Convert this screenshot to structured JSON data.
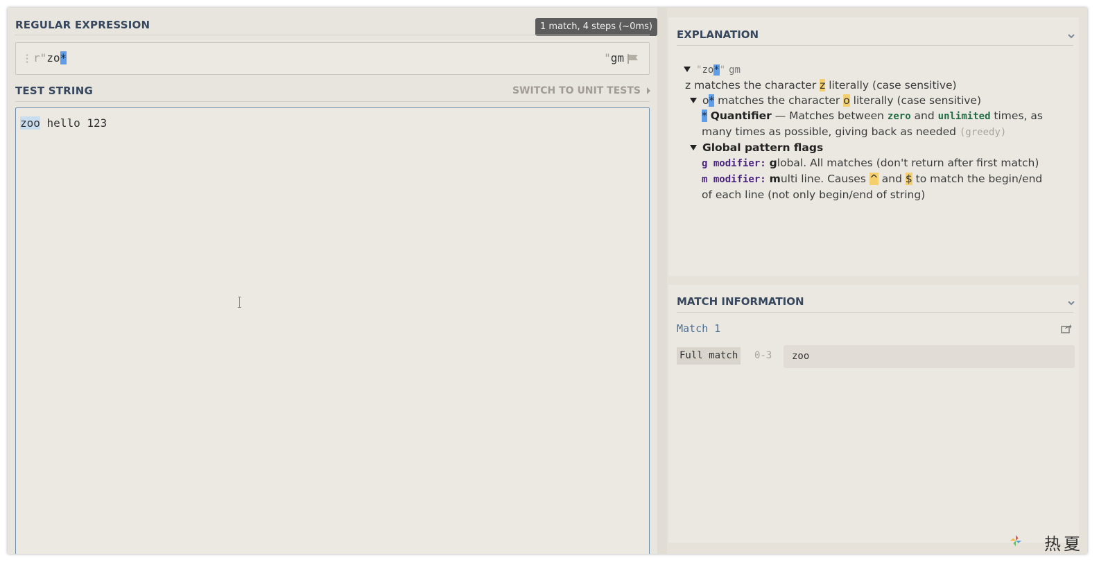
{
  "regex": {
    "header": "REGULAR EXPRESSION",
    "badge": "1 match, 4 steps (~0ms)",
    "prefix": "r\"",
    "pattern_plain": "zo",
    "pattern_highlight": "*",
    "suffix_quote": "\"",
    "flags": "gm"
  },
  "test": {
    "header": "TEST STRING",
    "switch_label": "SWITCH TO UNIT TESTS",
    "match_text": "zoo",
    "rest_text": " hello 123"
  },
  "explanation": {
    "title": "EXPLANATION",
    "root_q1": "\"",
    "root_pattern": "zo",
    "root_star": "*",
    "root_q2": "\"",
    "root_flags": "gm",
    "z_char": "z",
    "z_text_a": " matches the character ",
    "z_hl": "z",
    "z_text_b": " literally (case sensitive)",
    "o_char": "o",
    "o_star": "*",
    "o_text_a": " matches the character ",
    "o_hl": "o",
    "o_text_b": " literally (case sensitive)",
    "q_star": "*",
    "q_label": "Quantifier",
    "q_text_a": " — Matches between ",
    "q_zero": "zero",
    "q_and": " and ",
    "q_unlimited": "unlimited",
    "q_text_b": " times, as",
    "q_line2": "many times as possible, giving back as needed ",
    "q_greedy": "(greedy)",
    "flags_label": "Global pattern flags",
    "g_mod": "g modifier:",
    "g_bold": "g",
    "g_text": "lobal. All matches (don't return after first match)",
    "m_mod": "m modifier:",
    "m_bold": "m",
    "m_text_a": "ulti line. Causes ",
    "m_caret": "^",
    "m_and": " and ",
    "m_dollar": "$",
    "m_text_b": " to match the begin/end",
    "m_line2": "of each line (not only begin/end of string)"
  },
  "match_info": {
    "title": "MATCH INFORMATION",
    "match_label": "Match 1",
    "full_match_label": "Full match",
    "range": "0-3",
    "value": "zoo"
  },
  "watermark": {
    "text": "热夏"
  },
  "colors": {
    "accent_blue": "#5f9de6",
    "highlight_yellow": "#f3cf6e",
    "header_text": "#36475e"
  },
  "icons": [
    "flag-icon",
    "chevron-down-icon",
    "share-icon",
    "caret-right-icon",
    "pinwheel-logo-icon"
  ]
}
